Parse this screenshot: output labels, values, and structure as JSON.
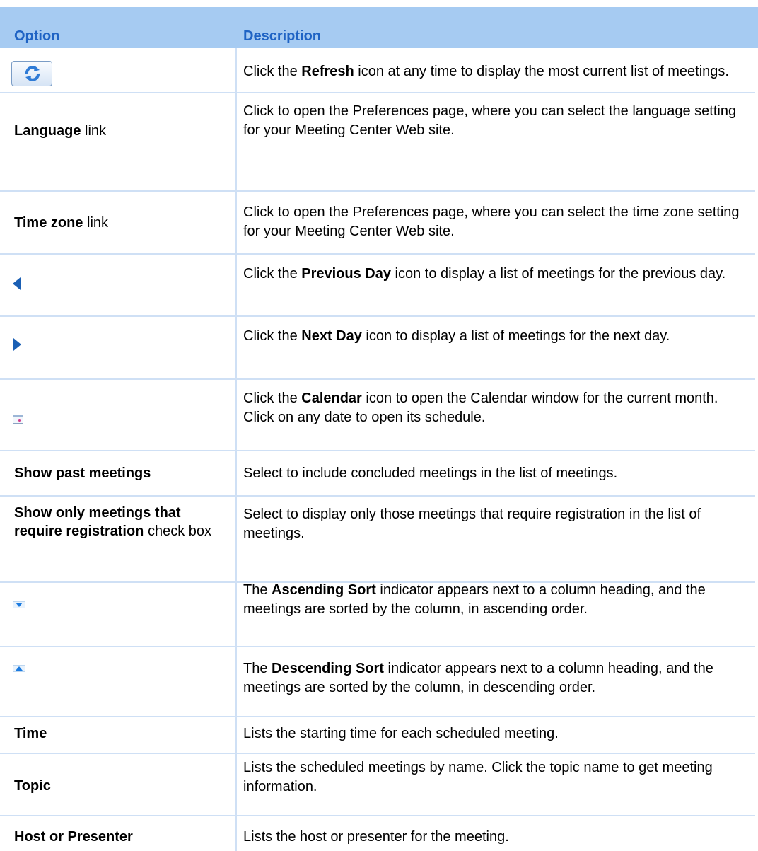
{
  "header": {
    "option": "Option",
    "description": "Description"
  },
  "rows": [
    {
      "option_icon": "refresh-icon",
      "desc": {
        "pre": "Click the ",
        "bold": "Refresh",
        "post": " icon at any time to display the most current list of meetings."
      }
    },
    {
      "option": {
        "bold": "Language",
        "post": " link"
      },
      "desc": {
        "pre": "Click to open the Preferences page, where you can select the language setting for your Meeting Center Web site.",
        "bold": "",
        "post": ""
      }
    },
    {
      "option": {
        "bold": "Time zone",
        "post": " link"
      },
      "desc": {
        "pre": "Click to open the Preferences page, where you can select the time zone setting for your Meeting Center Web site.",
        "bold": "",
        "post": ""
      }
    },
    {
      "option_icon": "previous-day-icon",
      "desc": {
        "pre": "Click the ",
        "bold": "Previous Day",
        "post": " icon to display a list of meetings for the previous day."
      }
    },
    {
      "option_icon": "next-day-icon",
      "desc": {
        "pre": "Click the ",
        "bold": "Next Day",
        "post": " icon to display a list of meetings for the next day."
      }
    },
    {
      "option_icon": "calendar-icon",
      "desc": {
        "pre": "Click the ",
        "bold": "Calendar",
        "post": " icon to open the Calendar window for the current month. Click on any date to open its schedule."
      }
    },
    {
      "option": {
        "bold": "Show past meetings",
        "post": ""
      },
      "desc": {
        "pre": "Select to include concluded meetings in the list of meetings.",
        "bold": "",
        "post": ""
      }
    },
    {
      "option": {
        "bold": "Show only meetings that require registration",
        "post": " check box"
      },
      "desc": {
        "pre": "Select to display only those meetings that require registration in the list of meetings.",
        "bold": "",
        "post": ""
      }
    },
    {
      "option_icon": "ascending-sort-icon",
      "desc": {
        "pre": "The ",
        "bold": "Ascending Sort",
        "post": " indicator appears next to a column heading, and the meetings are sorted by the column, in ascending order."
      }
    },
    {
      "option_icon": "descending-sort-icon",
      "desc": {
        "pre": "The ",
        "bold": "Descending Sort",
        "post": " indicator appears next to a column heading, and the meetings are sorted by the column, in descending order."
      }
    },
    {
      "option": {
        "bold": "Time",
        "post": ""
      },
      "desc": {
        "pre": "Lists the starting time for each scheduled meeting.",
        "bold": "",
        "post": ""
      }
    },
    {
      "option": {
        "bold": "Topic",
        "post": ""
      },
      "desc": {
        "pre": "Lists the scheduled meetings by name. Click the topic name to get meeting information.",
        "bold": "",
        "post": ""
      }
    },
    {
      "option": {
        "bold": "Host or Presenter",
        "post": ""
      },
      "desc": {
        "pre": "Lists the host or presenter for the meeting.",
        "bold": "",
        "post": ""
      }
    }
  ],
  "colors": {
    "header_band": "#a6cbf2",
    "header_text": "#1f63c4",
    "grid": "#cfe0f5",
    "icon_blue": "#1a5fb4"
  }
}
